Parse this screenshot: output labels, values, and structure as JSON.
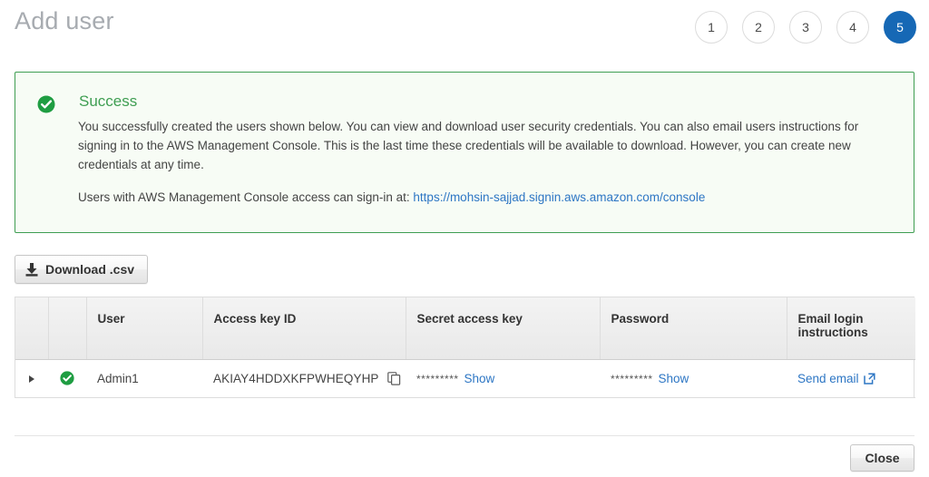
{
  "header": {
    "title": "Add user",
    "steps": [
      {
        "label": "1",
        "active": false
      },
      {
        "label": "2",
        "active": false
      },
      {
        "label": "3",
        "active": false
      },
      {
        "label": "4",
        "active": false
      },
      {
        "label": "5",
        "active": true
      }
    ],
    "active_step_color": "#1668b5"
  },
  "alert": {
    "icon": "success-check-icon",
    "title": "Success",
    "title_color": "#3f9e52",
    "body": "You successfully created the users shown below. You can view and download user security credentials. You can also email users instructions for signing in to the AWS Management Console. This is the last time these credentials will be available to download. However, you can create new credentials at any time.",
    "signin_prefix": "Users with AWS Management Console access can sign-in at: ",
    "signin_url": "https://mohsin-sajjad.signin.aws.amazon.com/console",
    "link_color": "#2d76c4",
    "border_color": "#3f9e52",
    "background_color": "#f7fcf5"
  },
  "toolbar": {
    "download_label": "Download .csv",
    "download_icon": "download-icon"
  },
  "table": {
    "columns": [
      {
        "label": "",
        "name": "expander"
      },
      {
        "label": "",
        "name": "status"
      },
      {
        "label": "User",
        "name": "user"
      },
      {
        "label": "Access key ID",
        "name": "access-key-id"
      },
      {
        "label": "Secret access key",
        "name": "secret-access-key"
      },
      {
        "label": "Password",
        "name": "password"
      },
      {
        "label": "Email login instructions",
        "name": "email-login-instructions"
      }
    ],
    "rows": [
      {
        "expander_icon": "triangle-right-icon",
        "status_icon": "success-check-icon",
        "user": "Admin1",
        "access_key_id": "AKIAY4HDDXKFPWHEQYHP",
        "copy_icon": "copy-icon",
        "secret_access_key_masked": "*********",
        "secret_show_label": "Show",
        "password_masked": "*********",
        "password_show_label": "Show",
        "email_label": "Send email",
        "email_icon": "external-link-icon"
      }
    ]
  },
  "footer": {
    "close_label": "Close"
  }
}
